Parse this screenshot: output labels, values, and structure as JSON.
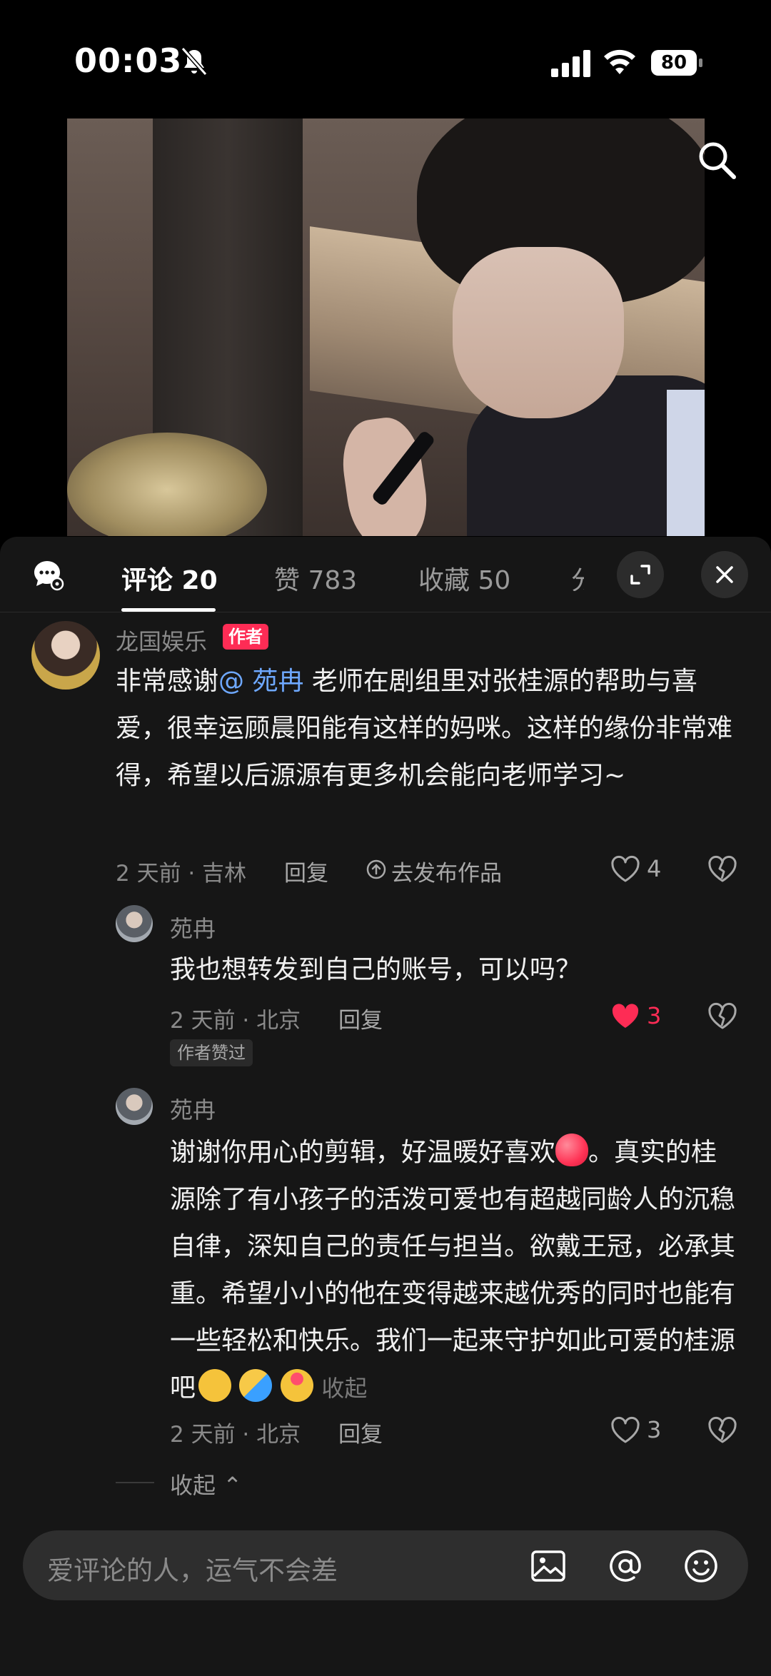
{
  "status_bar": {
    "time": "00:03",
    "battery": "80"
  },
  "tabs": [
    {
      "label": "评论 20"
    },
    {
      "label": "赞 783"
    },
    {
      "label": "收藏 50"
    }
  ],
  "comments": {
    "main": {
      "username": "龙国娱乐",
      "badge": "作者",
      "text_before": "非常感谢",
      "mention": "@ 苑冉",
      "text_after": " 老师在剧组里对张桂源的帮助与喜爱，很幸运顾晨阳能有这样的妈咪。这样的缘份非常难得，希望以后源源有更多机会能向老师学习~",
      "meta": "2 天前 · 吉林",
      "reply": "回复",
      "publish": "去发布作品",
      "likes": "4"
    },
    "reply1": {
      "username": "苑冉",
      "text": "我也想转发到自己的账号，可以吗？",
      "meta": "2 天前 · 北京",
      "reply": "回复",
      "likes": "3",
      "tag": "作者赞过"
    },
    "reply2": {
      "username": "苑冉",
      "text_line1": "谢谢你用心的剪辑，好温暖好喜欢",
      "text_line1_end": "。真实",
      "text_rest": "的桂源除了有小孩子的活泼可爱也有超越同龄人的沉稳自律，深知自己的责任与担当。欲戴王冠，必承其重。希望小小的他在变得越来越优秀的同时也能有一些轻松和快乐。我们一起来守护如此可爱的桂源吧",
      "collapse_inline": "收起",
      "meta": "2 天前 · 北京",
      "reply": "回复",
      "likes": "3"
    }
  },
  "collapse_label": "收起",
  "input": {
    "placeholder": "爱评论的人，运气不会差"
  },
  "colors": {
    "accent": "#fe2c55",
    "mention": "#6ea8ff",
    "panel": "#161616"
  },
  "icons": [
    "mute-icon",
    "signal-icon",
    "wifi-icon",
    "search-icon",
    "comment-bubble-icon",
    "expand-icon",
    "close-icon",
    "heart-icon",
    "broken-heart-icon",
    "image-icon",
    "at-icon",
    "emoji-icon"
  ]
}
